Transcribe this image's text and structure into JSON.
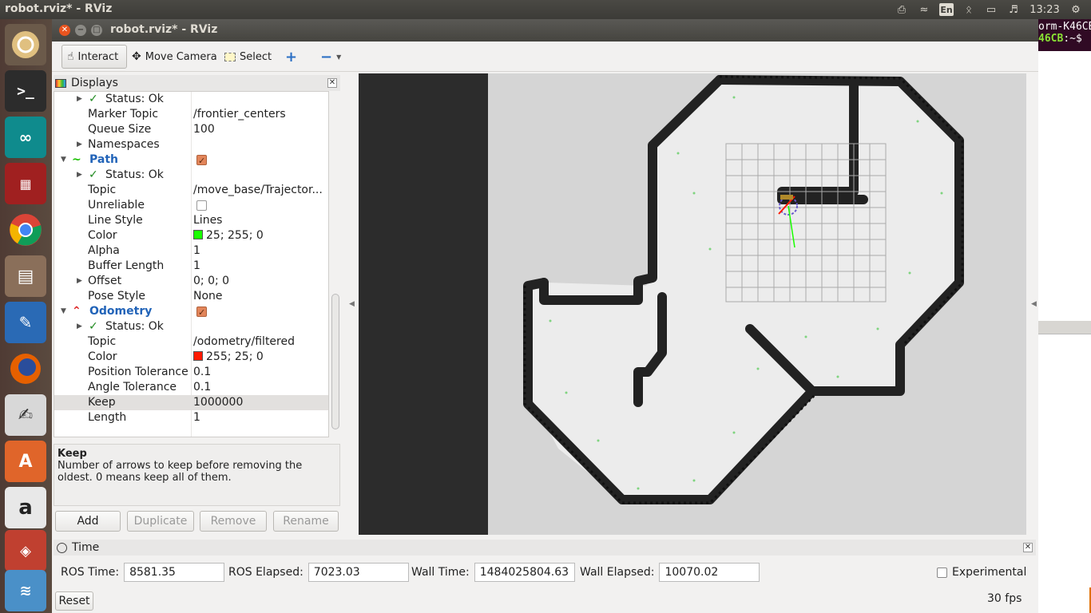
{
  "topbar": {
    "window_title": "robot.rviz* - RViz",
    "lang": "En",
    "clock": "13:23"
  },
  "terminal": {
    "line1": "orm-K46CB",
    "prompt_user": "46CB",
    "prompt_rest": ":~$"
  },
  "window": {
    "title": "robot.rviz* - RViz"
  },
  "toolbar": {
    "interact": "Interact",
    "move_camera": "Move Camera",
    "select": "Select"
  },
  "displays": {
    "title": "Displays",
    "rows": [
      {
        "key": "Status: Ok",
        "value": ""
      },
      {
        "key": "Marker Topic",
        "value": "/frontier_centers"
      },
      {
        "key": "Queue Size",
        "value": "100"
      },
      {
        "key": "Namespaces",
        "value": ""
      },
      {
        "key": "Path",
        "value": ""
      },
      {
        "key": "Status: Ok",
        "value": ""
      },
      {
        "key": "Topic",
        "value": "/move_base/Trajector..."
      },
      {
        "key": "Unreliable",
        "value": ""
      },
      {
        "key": "Line Style",
        "value": "Lines"
      },
      {
        "key": "Color",
        "value": "25; 255; 0"
      },
      {
        "key": "Alpha",
        "value": "1"
      },
      {
        "key": "Buffer Length",
        "value": "1"
      },
      {
        "key": "Offset",
        "value": "0; 0; 0"
      },
      {
        "key": "Pose Style",
        "value": "None"
      },
      {
        "key": "Odometry",
        "value": ""
      },
      {
        "key": "Status: Ok",
        "value": ""
      },
      {
        "key": "Topic",
        "value": "/odometry/filtered"
      },
      {
        "key": "Color",
        "value": "255; 25; 0"
      },
      {
        "key": "Position Tolerance",
        "value": "0.1"
      },
      {
        "key": "Angle Tolerance",
        "value": "0.1"
      },
      {
        "key": "Keep",
        "value": "1000000"
      },
      {
        "key": "Length",
        "value": "1"
      }
    ],
    "path_color": "#19ff00",
    "odom_color": "#ff1900"
  },
  "description": {
    "title": "Keep",
    "text": "Number of arrows to keep before removing the oldest. 0 means keep all of them."
  },
  "buttons": {
    "add": "Add",
    "duplicate": "Duplicate",
    "remove": "Remove",
    "rename": "Rename"
  },
  "time": {
    "title": "Time",
    "ros_time_label": "ROS Time:",
    "ros_time": "8581.35",
    "ros_elapsed_label": "ROS Elapsed:",
    "ros_elapsed": "7023.03",
    "wall_time_label": "Wall Time:",
    "wall_time": "1484025804.63",
    "wall_elapsed_label": "Wall Elapsed:",
    "wall_elapsed": "10070.02",
    "experimental": "Experimental",
    "reset": "Reset",
    "fps": "30 fps"
  }
}
